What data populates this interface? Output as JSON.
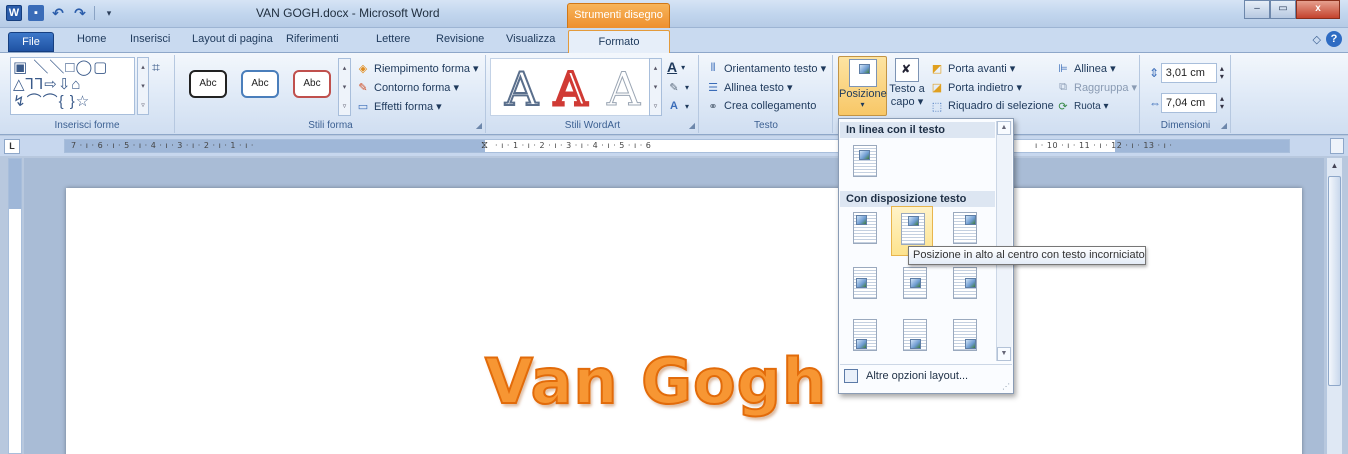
{
  "window": {
    "title": "VAN GOGH.docx - Microsoft Word",
    "context_header": "Strumenti disegno",
    "buttons": {
      "minimize": "–",
      "maximize": "▭",
      "close": "x"
    }
  },
  "tabs": {
    "file": "File",
    "items": [
      "Home",
      "Inserisci",
      "Layout di pagina",
      "Riferimenti",
      "Lettere",
      "Revisione",
      "Visualizza"
    ],
    "active": "Formato"
  },
  "ribbon": {
    "insert_shapes": {
      "label": "Inserisci forme",
      "shapes_glyphs": "▣ ＼ ＼ □ ◯ ▢\n△ ⅂ ⅂ ⇨ ⇩ ⌂\n↯ ⌒ ⌒ { } ☆"
    },
    "shape_styles": {
      "label": "Stili forma",
      "gallery": [
        "Abc",
        "Abc",
        "Abc"
      ],
      "fill": "Riempimento forma ▾",
      "outline": "Contorno forma ▾",
      "effects": "Effetti forma ▾"
    },
    "wordart_styles": {
      "label": "Stili WordArt",
      "letters": [
        "A",
        "A",
        "A"
      ]
    },
    "text": {
      "label": "Testo",
      "direction": "Orientamento testo ▾",
      "align": "Allinea testo ▾",
      "link": "Crea collegamento"
    },
    "arrange": {
      "position": "Posizione",
      "position_arrow": "▾",
      "wrap_line1": "Testo a",
      "wrap_line2": "capo ▾",
      "bring_forward": "Porta avanti ▾",
      "send_backward": "Porta indietro ▾",
      "selection_pane": "Riquadro di selezione",
      "align": "Allinea ▾",
      "group": "Raggruppa ▾",
      "rotate": "Ruota ▾"
    },
    "size": {
      "label": "Dimensioni",
      "height": "3,01 cm",
      "width": "7,04 cm"
    }
  },
  "ruler": {
    "tab_selector": "L",
    "left_ticks": "7 · ı · 6 · ı · 5 · ı · 4 · ı · 3 · ı · 2 · ı · 1 · ı ·",
    "mid_ticks": "· ı · 1 · ı · 2 · ı · 3 · ı · 4 · ı · 5 · ı · 6",
    "right_ticks": "ı · 10 · ı · 11 · ı · 12 · ı · 13 · ı ·"
  },
  "document": {
    "wordart_text": "Van Gogh"
  },
  "position_menu": {
    "inline_header": "In linea con il testo",
    "wrap_header": "Con disposizione testo",
    "footer": "Altre opzioni layout...",
    "tooltip": "Posizione in alto al centro con testo incorniciato"
  },
  "colors": {
    "accent_orange": "#f79633",
    "file_tab": "#1f52a3",
    "ribbon_bg": "#dde8f6"
  }
}
